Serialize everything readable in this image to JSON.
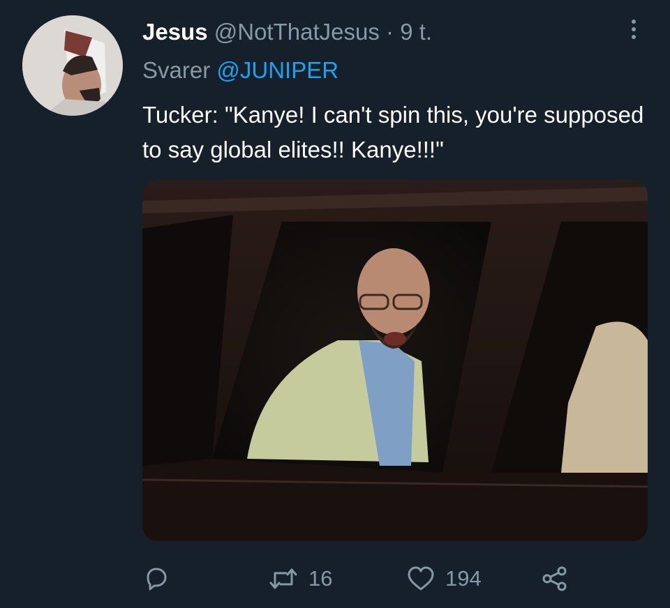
{
  "tweet": {
    "display_name": "Jesus",
    "handle": "@NotThatJesus",
    "separator": "·",
    "time": "9 t.",
    "reply_prefix": "Svarer",
    "reply_to": "@JUNIPER",
    "text": "Tucker: \"Kanye! I can't spin this, you're supposed to say global elites!! Kanye!!!\"",
    "more_icon": "more-vertical-icon"
  },
  "actions": {
    "reply_icon": "reply-icon",
    "retweet_icon": "retweet-icon",
    "retweet_count": "16",
    "like_icon": "heart-icon",
    "like_count": "194",
    "share_icon": "share-icon"
  },
  "colors": {
    "background": "#15202b",
    "text": "#ffffff",
    "muted": "#8899a6",
    "link": "#1da1f2"
  }
}
